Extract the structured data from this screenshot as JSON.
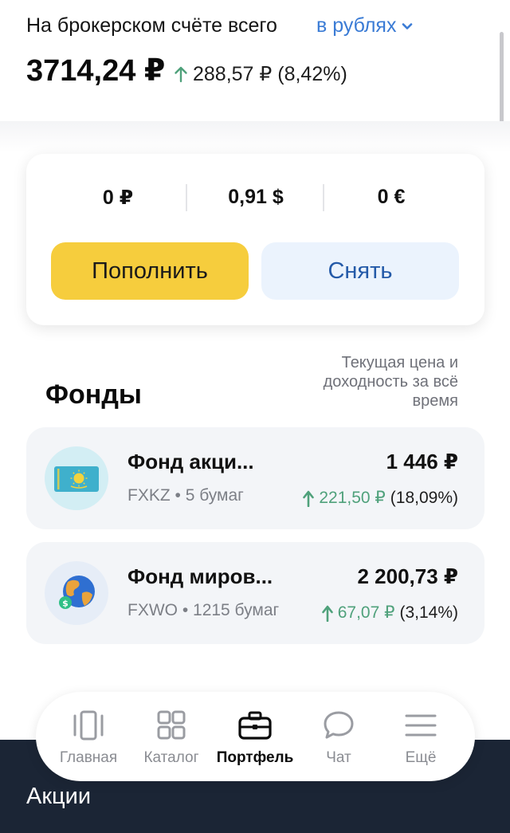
{
  "header": {
    "title": "На брокерском счёте всего",
    "currency_select": "в рублях",
    "total": "3714,24 ₽",
    "gain": "288,57 ₽ (8,42%)"
  },
  "balances": {
    "rub": "0 ₽",
    "usd": "0,91 $",
    "eur": "0 €"
  },
  "actions": {
    "topup_label": "Пополнить",
    "withdraw_label": "Снять"
  },
  "funds_section": {
    "title": "Фонды",
    "note": "Текущая цена и доходность за всё время"
  },
  "funds": [
    {
      "name": "Фонд акци...",
      "ticker_info": "FXKZ • 5 бумаг",
      "value": "1 446 ₽",
      "change_value": "221,50 ₽",
      "change_percent": "(18,09%)",
      "icon": "kazakhstan-flag-icon"
    },
    {
      "name": "Фонд миров...",
      "ticker_info": "FXWO • 1215 бумаг",
      "value": "2 200,73 ₽",
      "change_value": "67,07 ₽",
      "change_percent": "(3,14%)",
      "icon": "globe-icon"
    }
  ],
  "next_section_label": "Акции",
  "tabbar": {
    "items": [
      {
        "label": "Главная",
        "icon": "home-cards-icon",
        "active": false
      },
      {
        "label": "Каталог",
        "icon": "grid-icon",
        "active": false
      },
      {
        "label": "Портфель",
        "icon": "briefcase-icon",
        "active": true
      },
      {
        "label": "Чат",
        "icon": "chat-bubble-icon",
        "active": false
      },
      {
        "label": "Ещё",
        "icon": "menu-icon",
        "active": false
      }
    ]
  },
  "colors": {
    "accent_blue": "#3a7bd5",
    "topup_yellow": "#f6cd3d",
    "gain_green": "#4fa17b",
    "dark_bar": "#1b2535"
  }
}
